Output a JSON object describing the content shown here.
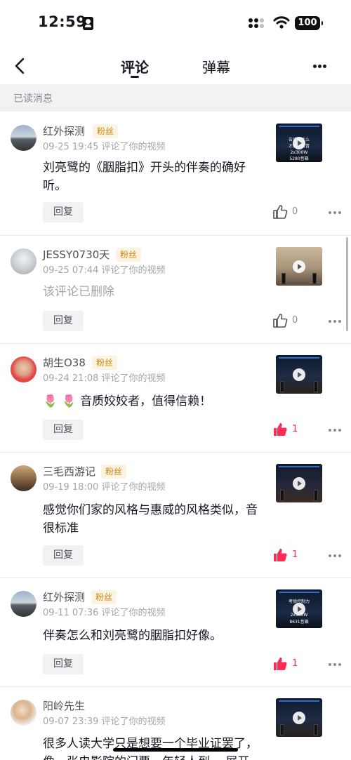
{
  "status_bar": {
    "time": "12:59",
    "battery": "100"
  },
  "nav": {
    "tab_comments": "评论",
    "tab_danmaku": "弹幕"
  },
  "section_header": "已读消息",
  "reply_label": "回复",
  "accent_color": "#fe2c55",
  "comments": [
    {
      "user": "红外探测",
      "badge": "粉丝",
      "meta": "09-25 19:45 评论了你的视频",
      "text": "刘亮鹭的《胭脂扣》开头的伴奏的确好听。",
      "likes": "0",
      "liked": false,
      "thumb_caption": [
        "告诉你什么",
        "才能在听音",
        "2x300W",
        "5280音箱"
      ]
    },
    {
      "user": "JESSY0730天",
      "badge": "粉丝",
      "meta": "09-25 07:44 评论了你的视频",
      "text": "该评论已删除",
      "likes": "0",
      "liked": false,
      "thumb_caption": []
    },
    {
      "user": "胡生O38",
      "badge": "粉丝",
      "meta": "09-24 21:08 评论了你的视频",
      "text": "🌷 🌷 音质姣姣者，值得信赖！",
      "likes": "1",
      "liked": true,
      "thumb_caption": []
    },
    {
      "user": "三毛西游记",
      "badge": "粉丝",
      "meta": "09-19 18:00 评论了你的视频",
      "text": "感觉你们家的风格与惠威的风格类似，音很标准",
      "likes": "1",
      "liked": true,
      "thumb_caption": []
    },
    {
      "user": "红外探测",
      "badge": "粉丝",
      "meta": "09-11 07:36 评论了你的视频",
      "text": "伴奏怎么和刘亮鹭的胭脂扣好像。",
      "likes": "1",
      "liked": true,
      "thumb_caption": [
        "考验控制力",
        "2x300W",
        "8631音箱"
      ]
    },
    {
      "user": "阳岭先生",
      "badge": "",
      "meta": "09-07 23:39 评论了你的视频",
      "text": "很多人读大学只是想要一个毕业证罢了，像一张电影院的门票，年轻人到… 展开",
      "likes": "",
      "liked": false,
      "thumb_caption": []
    }
  ]
}
